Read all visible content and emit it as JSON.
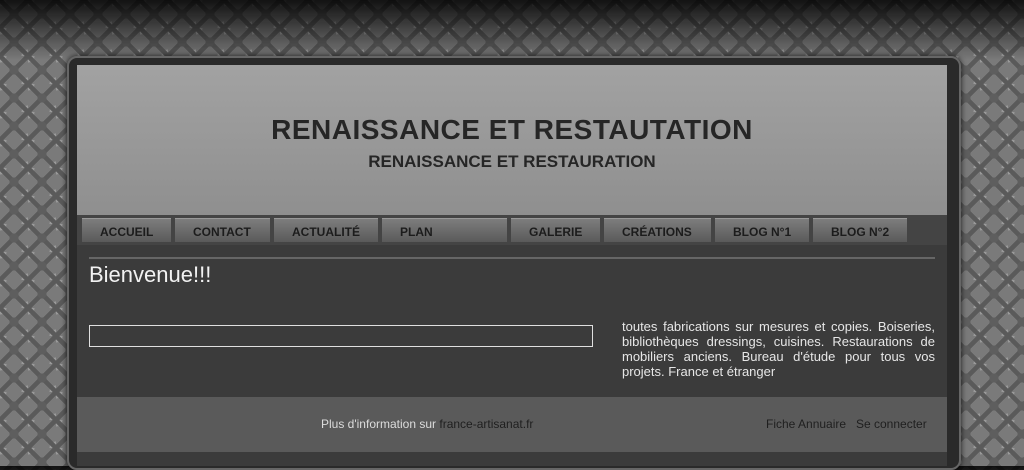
{
  "header": {
    "title": "RENAISSANCE ET RESTAUTATION",
    "subtitle": "RENAISSANCE ET RESTAURATION"
  },
  "nav": {
    "items": [
      {
        "label": "ACCUEIL"
      },
      {
        "label": "CONTACT"
      },
      {
        "label": "ACTUALITÉ"
      },
      {
        "label": "PLAN"
      },
      {
        "label": "GALERIE"
      },
      {
        "label": "CRÉATIONS"
      },
      {
        "label": "BLOG N°1"
      },
      {
        "label": "BLOG N°2"
      }
    ]
  },
  "main": {
    "welcome": "Bienvenue!!!",
    "description": "toutes fabrications sur mesures et copies. Boiseries, bibliothèques dressings, cuisines. Restaurations de mobiliers anciens. Bureau d'étude pour tous vos projets. France et étranger"
  },
  "footer": {
    "info_prefix": "Plus d'information sur",
    "info_link": "france-artisanat.fr",
    "directory_link": "Fiche Annuaire",
    "login_link": "Se connecter"
  },
  "colors": {
    "header_bg": "#9a9a9a",
    "panel_bg": "#3b3b3b",
    "footer_bg": "#5a5a5a",
    "title_text": "#262626"
  }
}
